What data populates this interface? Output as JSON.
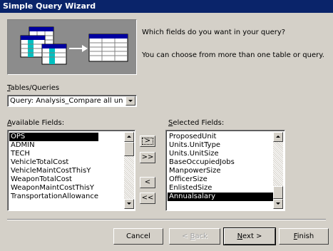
{
  "window": {
    "title": "Simple Query Wizard"
  },
  "intro": {
    "question": "Which fields do you want in your query?",
    "hint": "You can choose from more than one table or query."
  },
  "tables": {
    "label_hotkey": "T",
    "label_rest": "ables/Queries",
    "selected": "Query: Analysis_Compare all uni"
  },
  "available": {
    "label_hotkey": "A",
    "label_rest": "vailable Fields:",
    "items": [
      "OPS",
      "ADMIN",
      "TECH",
      "VehicleTotalCost",
      "VehicleMaintCostThisY",
      "WeaponTotalCost",
      "WeaponMaintCostThisY",
      "TransportationAllowance"
    ],
    "selected_index": 0
  },
  "selected_fields": {
    "label_hotkey": "S",
    "label_rest": "elected Fields:",
    "items": [
      "ProposedUnit",
      "Units.UnitType",
      "Units.UnitSize",
      "BaseOccupiedJobs",
      "ManpowerSize",
      "OfficerSize",
      "EnlistedSize",
      "Annualsalary"
    ],
    "selected_index": 7
  },
  "move": {
    "add_one": ">",
    "add_all": ">>",
    "remove_one": "<",
    "remove_all": "<<"
  },
  "buttons": {
    "cancel": "Cancel",
    "back_hotkey": "B",
    "back_pre": "< ",
    "back_rest": "ack",
    "next_hotkey": "N",
    "next_rest": "ext >",
    "finish_hotkey": "F",
    "finish_rest": "inish"
  }
}
